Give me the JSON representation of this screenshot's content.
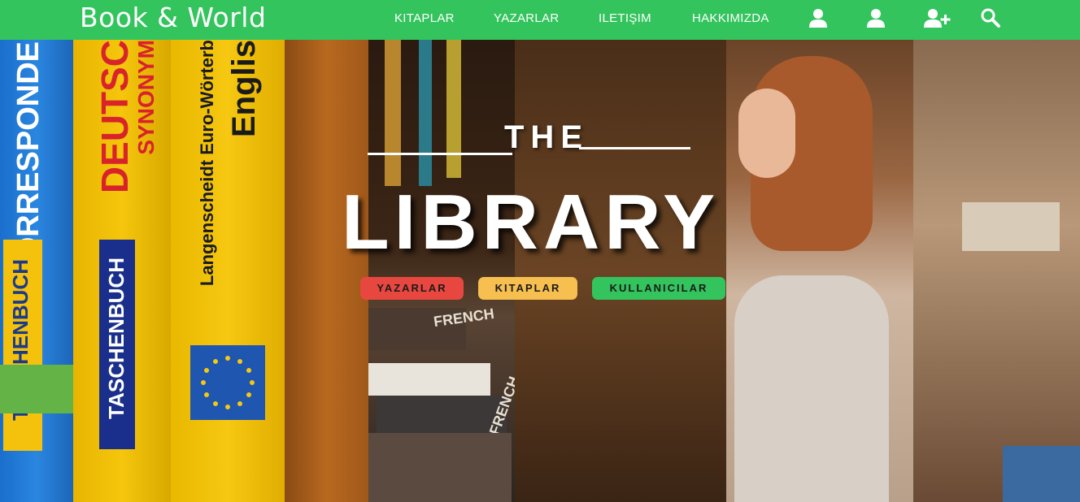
{
  "brand": {
    "name": "Book & World"
  },
  "nav": {
    "links": [
      "KITAPLAR",
      "YAZARLAR",
      "ILETIŞIM",
      "HAKKIMIZDA"
    ],
    "icons": [
      "user-icon",
      "user-icon",
      "user-plus-icon",
      "search-icon"
    ]
  },
  "hero": {
    "the": "THE",
    "library": "LIBRARY",
    "buttons": [
      {
        "label": "YAZARLAR",
        "color": "#e8473f"
      },
      {
        "label": "KITAPLAR",
        "color": "#f7bf4f"
      },
      {
        "label": "KULLANICILAR",
        "color": "#34c45e"
      }
    ]
  },
  "books": {
    "spines": [
      "KORRESPONDE",
      "TASCHENBUCH",
      "DEUTSC",
      "SYNONYM",
      "TASCHENBUCH",
      "Langenscheidt Euro-Wörterb",
      "Englis",
      "FRENCH",
      "FRENCH"
    ]
  },
  "colors": {
    "nav": "#34c45e",
    "text": "#ffffff"
  }
}
